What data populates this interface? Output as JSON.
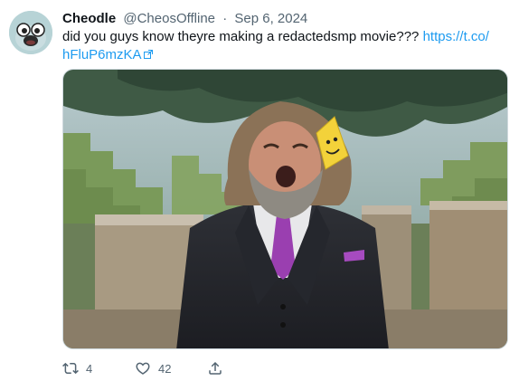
{
  "tweet": {
    "author": {
      "name": "Cheodle",
      "handle": "@CheosOffline",
      "separator": "·",
      "date": "Sep 6, 2024",
      "avatar_icon": "cartoon-face-avatar"
    },
    "text": "did you guys know theyre making a redactedsmp movie??? ",
    "link": {
      "line1": "https://t.co/",
      "line2": "hFluP6mzKA",
      "icon": "external-link-icon"
    },
    "media": {
      "description_icon": "photo-icon"
    },
    "actions": {
      "retweet_icon": "retweet-icon",
      "retweet_count": "4",
      "like_icon": "heart-icon",
      "like_count": "42",
      "share_icon": "share-icon"
    }
  },
  "colors": {
    "text": "#0f1419",
    "secondary": "#536471",
    "link": "#1d9bf0",
    "border": "#cfd9de"
  }
}
